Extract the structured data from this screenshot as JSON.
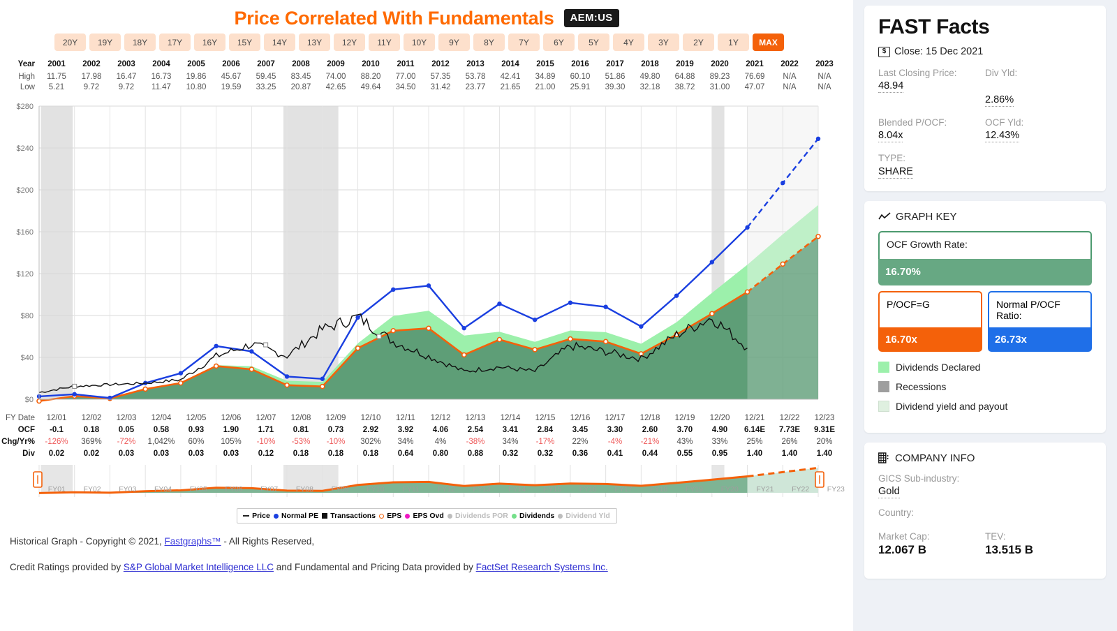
{
  "header": {
    "title": "Price Correlated With Fundamentals",
    "ticker": "AEM:US",
    "title_color": "#ff6a00"
  },
  "period_selector": {
    "options": [
      "20Y",
      "19Y",
      "18Y",
      "17Y",
      "16Y",
      "15Y",
      "14Y",
      "13Y",
      "12Y",
      "11Y",
      "10Y",
      "9Y",
      "8Y",
      "7Y",
      "6Y",
      "5Y",
      "4Y",
      "3Y",
      "2Y",
      "1Y",
      "MAX"
    ],
    "selected": "MAX"
  },
  "price_table": {
    "row_labels": [
      "Year",
      "High",
      "Low"
    ],
    "years": [
      "2001",
      "2002",
      "2003",
      "2004",
      "2005",
      "2006",
      "2007",
      "2008",
      "2009",
      "2010",
      "2011",
      "2012",
      "2013",
      "2014",
      "2015",
      "2016",
      "2017",
      "2018",
      "2019",
      "2020",
      "2021",
      "2022",
      "2023"
    ],
    "high": [
      "11.75",
      "17.98",
      "16.47",
      "16.73",
      "19.86",
      "45.67",
      "59.45",
      "83.45",
      "74.00",
      "88.20",
      "77.00",
      "57.35",
      "53.78",
      "42.41",
      "34.89",
      "60.10",
      "51.86",
      "49.80",
      "64.88",
      "89.23",
      "76.69",
      "N/A",
      "N/A"
    ],
    "low": [
      "5.21",
      "9.72",
      "9.72",
      "11.47",
      "10.80",
      "19.59",
      "33.25",
      "20.87",
      "42.65",
      "49.64",
      "34.50",
      "31.42",
      "23.77",
      "21.65",
      "21.00",
      "25.91",
      "39.30",
      "32.18",
      "38.72",
      "31.00",
      "47.07",
      "N/A",
      "N/A"
    ]
  },
  "fundamentals_table": {
    "row_labels": [
      "FY Date",
      "OCF",
      "Chg/Yr%",
      "Div"
    ],
    "fy_dates": [
      "12/01",
      "12/02",
      "12/03",
      "12/04",
      "12/05",
      "12/06",
      "12/07",
      "12/08",
      "12/09",
      "12/10",
      "12/11",
      "12/12",
      "12/13",
      "12/14",
      "12/15",
      "12/16",
      "12/17",
      "12/18",
      "12/19",
      "12/20",
      "12/21",
      "12/22",
      "12/23"
    ],
    "ocf": [
      "-0.1",
      "0.18",
      "0.05",
      "0.58",
      "0.93",
      "1.90",
      "1.71",
      "0.81",
      "0.73",
      "2.92",
      "3.92",
      "4.06",
      "2.54",
      "3.41",
      "2.84",
      "3.45",
      "3.30",
      "2.60",
      "3.70",
      "4.90",
      "6.14E",
      "7.73E",
      "9.31E"
    ],
    "chg_yr": [
      "-126%",
      "369%",
      "-72%",
      "1,042%",
      "60%",
      "105%",
      "-10%",
      "-53%",
      "-10%",
      "302%",
      "34%",
      "4%",
      "-38%",
      "34%",
      "-17%",
      "22%",
      "-4%",
      "-21%",
      "43%",
      "33%",
      "25%",
      "26%",
      "20%"
    ],
    "chg_yr_negative": [
      true,
      false,
      true,
      false,
      false,
      false,
      true,
      true,
      true,
      false,
      false,
      false,
      true,
      false,
      true,
      false,
      true,
      true,
      false,
      false,
      false,
      false,
      false
    ],
    "div": [
      "0.02",
      "0.02",
      "0.03",
      "0.03",
      "0.03",
      "0.03",
      "0.12",
      "0.18",
      "0.18",
      "0.18",
      "0.64",
      "0.80",
      "0.88",
      "0.32",
      "0.32",
      "0.36",
      "0.41",
      "0.44",
      "0.55",
      "0.95",
      "1.40",
      "1.40",
      "1.40"
    ]
  },
  "navigator": {
    "labels": [
      "FY01",
      "FY02",
      "FY03",
      "FY04",
      "FY05",
      "FY06",
      "FY07",
      "FY08",
      "FY09",
      "FY10",
      "FY11",
      "FY12",
      "FY13",
      "FY14",
      "FY15",
      "FY16",
      "FY17",
      "FY18",
      "FY19",
      "FY20",
      "FY21",
      "FY22",
      "FY23"
    ]
  },
  "chart_legend": [
    {
      "label": "Price",
      "marker": "dash",
      "color": "#222222",
      "dim": false
    },
    {
      "label": "Normal PE",
      "marker": "dot",
      "color": "#1a3fe0",
      "dim": false
    },
    {
      "label": "Transactions",
      "marker": "square",
      "color": "#111111",
      "dim": false
    },
    {
      "label": "EPS",
      "marker": "ring",
      "color": "#f4610a",
      "dim": false
    },
    {
      "label": "EPS Ovd",
      "marker": "dot",
      "color": "#ef18c3",
      "dim": false
    },
    {
      "label": "Dividends POR",
      "marker": "dot",
      "color": "#bdbdbd",
      "dim": true
    },
    {
      "label": "Dividends",
      "marker": "dot",
      "color": "#74e08a",
      "dim": false
    },
    {
      "label": "Dividend Yld",
      "marker": "dot",
      "color": "#bdbdbd",
      "dim": true
    }
  ],
  "footer": {
    "line1_a": "Historical Graph - Copyright © 2021, ",
    "line1_link": "Fastgraphs™",
    "line1_b": " - All Rights Reserved,",
    "line2_a": "Credit Ratings provided by ",
    "line2_link1": "S&P Global Market Intelligence LLC",
    "line2_b": " and Fundamental and Pricing Data provided by ",
    "line2_link2": "FactSet Research Systems Inc."
  },
  "sidebar": {
    "fast_facts": {
      "title": "FAST Facts",
      "close_label": "Close: 15 Dec 2021",
      "dollar_glyph": "$",
      "items": [
        {
          "label": "Last Closing Price:",
          "value": "48.94"
        },
        {
          "label": "Div Yld:",
          "value": "2.86%"
        },
        {
          "label": "Blended P/OCF:",
          "value": "8.04x"
        },
        {
          "label": "OCF Yld:",
          "value": "12.43%"
        },
        {
          "label": "TYPE:",
          "value": "SHARE"
        }
      ]
    },
    "graph_key": {
      "heading": "GRAPH KEY",
      "growth_label": "OCF Growth Rate:",
      "growth_value": "16.70%",
      "pocf_g_label": "P/OCF=G",
      "pocf_g_value": "16.70x",
      "normal_pocf_label": "Normal P/OCF Ratio:",
      "normal_pocf_value": "26.73x",
      "swatches": [
        {
          "label": "Dividends Declared",
          "color": "#9cf0ab"
        },
        {
          "label": "Recessions",
          "color": "#9e9e9e"
        },
        {
          "label": "Dividend yield and payout",
          "color": "#dff0e0"
        }
      ]
    },
    "company_info": {
      "heading": "COMPANY INFO",
      "fields": [
        {
          "label": "GICS Sub-industry:",
          "value": "Gold"
        },
        {
          "label": "Country:",
          "value": ""
        },
        {
          "label": "Market Cap:",
          "value": "12.067 B"
        },
        {
          "label": "TEV:",
          "value": "13.515 B"
        }
      ]
    }
  },
  "chart_data": {
    "type": "line",
    "title": "Price Correlated With Fundamentals",
    "subtitle": "AEM:US",
    "xlabel": "",
    "ylabel": "",
    "ylim": [
      0,
      280
    ],
    "yticks": [
      "$0",
      "$40",
      "$80",
      "$120",
      "$160",
      "$200",
      "$240",
      "$280"
    ],
    "ytick_values": [
      0,
      40,
      80,
      120,
      160,
      200,
      240,
      280
    ],
    "grid": true,
    "legend_position": "bottom",
    "x_categories": [
      "12/01",
      "12/02",
      "12/03",
      "12/04",
      "12/05",
      "12/06",
      "12/07",
      "12/08",
      "12/09",
      "12/10",
      "12/11",
      "12/12",
      "12/13",
      "12/14",
      "12/15",
      "12/16",
      "12/17",
      "12/18",
      "12/19",
      "12/20",
      "12/21",
      "12/22",
      "12/23"
    ],
    "series": [
      {
        "name": "Normal PE",
        "color": "#1a3fe0",
        "note": "Normal P/OCF Ratio 26.73x applied to OCF",
        "values": [
          2.7,
          4.8,
          1.3,
          15.5,
          24.9,
          50.8,
          45.7,
          21.7,
          19.5,
          78.1,
          104.8,
          108.5,
          67.9,
          91.2,
          75.9,
          92.2,
          88.2,
          69.5,
          98.9,
          131.0,
          164.1,
          206.6,
          248.8
        ]
      },
      {
        "name": "EPS",
        "color": "#f4610a",
        "note": "P/OCF=G 16.70x applied to OCF (orange fair value line)",
        "values": [
          -1.7,
          3.0,
          0.8,
          9.7,
          15.5,
          31.7,
          28.6,
          13.5,
          12.2,
          48.8,
          65.5,
          67.8,
          42.4,
          57.0,
          47.4,
          57.6,
          55.1,
          43.4,
          61.8,
          81.8,
          102.5,
          129.1,
          155.5
        ]
      },
      {
        "name": "Dividends",
        "color": "#74e08a",
        "note": "green stacked dividend area above the orange fair-value line",
        "values": [
          0.4,
          0.6,
          0.7,
          0.7,
          0.8,
          0.9,
          3.0,
          4.2,
          4.4,
          4.6,
          14.0,
          16.8,
          18.4,
          7.5,
          7.4,
          8.1,
          9.0,
          9.6,
          11.8,
          19.8,
          26.0,
          28.5,
          30.0
        ]
      },
      {
        "name": "Price",
        "color": "#111111",
        "note": "monthly stock price (black line)",
        "values": [
          6.5,
          12.4,
          14.0,
          15.4,
          18.7,
          41.0,
          52.5,
          41.4,
          66.8,
          78.6,
          55.0,
          41.0,
          26.6,
          30.8,
          26.6,
          51.0,
          45.5,
          38.7,
          61.5,
          78.2,
          48.94,
          null,
          null
        ]
      }
    ],
    "recession_bands": [
      [
        "2001-03",
        "2001-11"
      ],
      [
        "2007-12",
        "2009-06"
      ],
      [
        "2020-02",
        "2020-04"
      ]
    ],
    "forecast_start": "12/21",
    "annotations": {
      "last_close": 48.94,
      "blended_p_ocf": "8.04x",
      "ocf_growth_rate": "16.70%",
      "normal_p_ocf": "26.73x"
    }
  }
}
